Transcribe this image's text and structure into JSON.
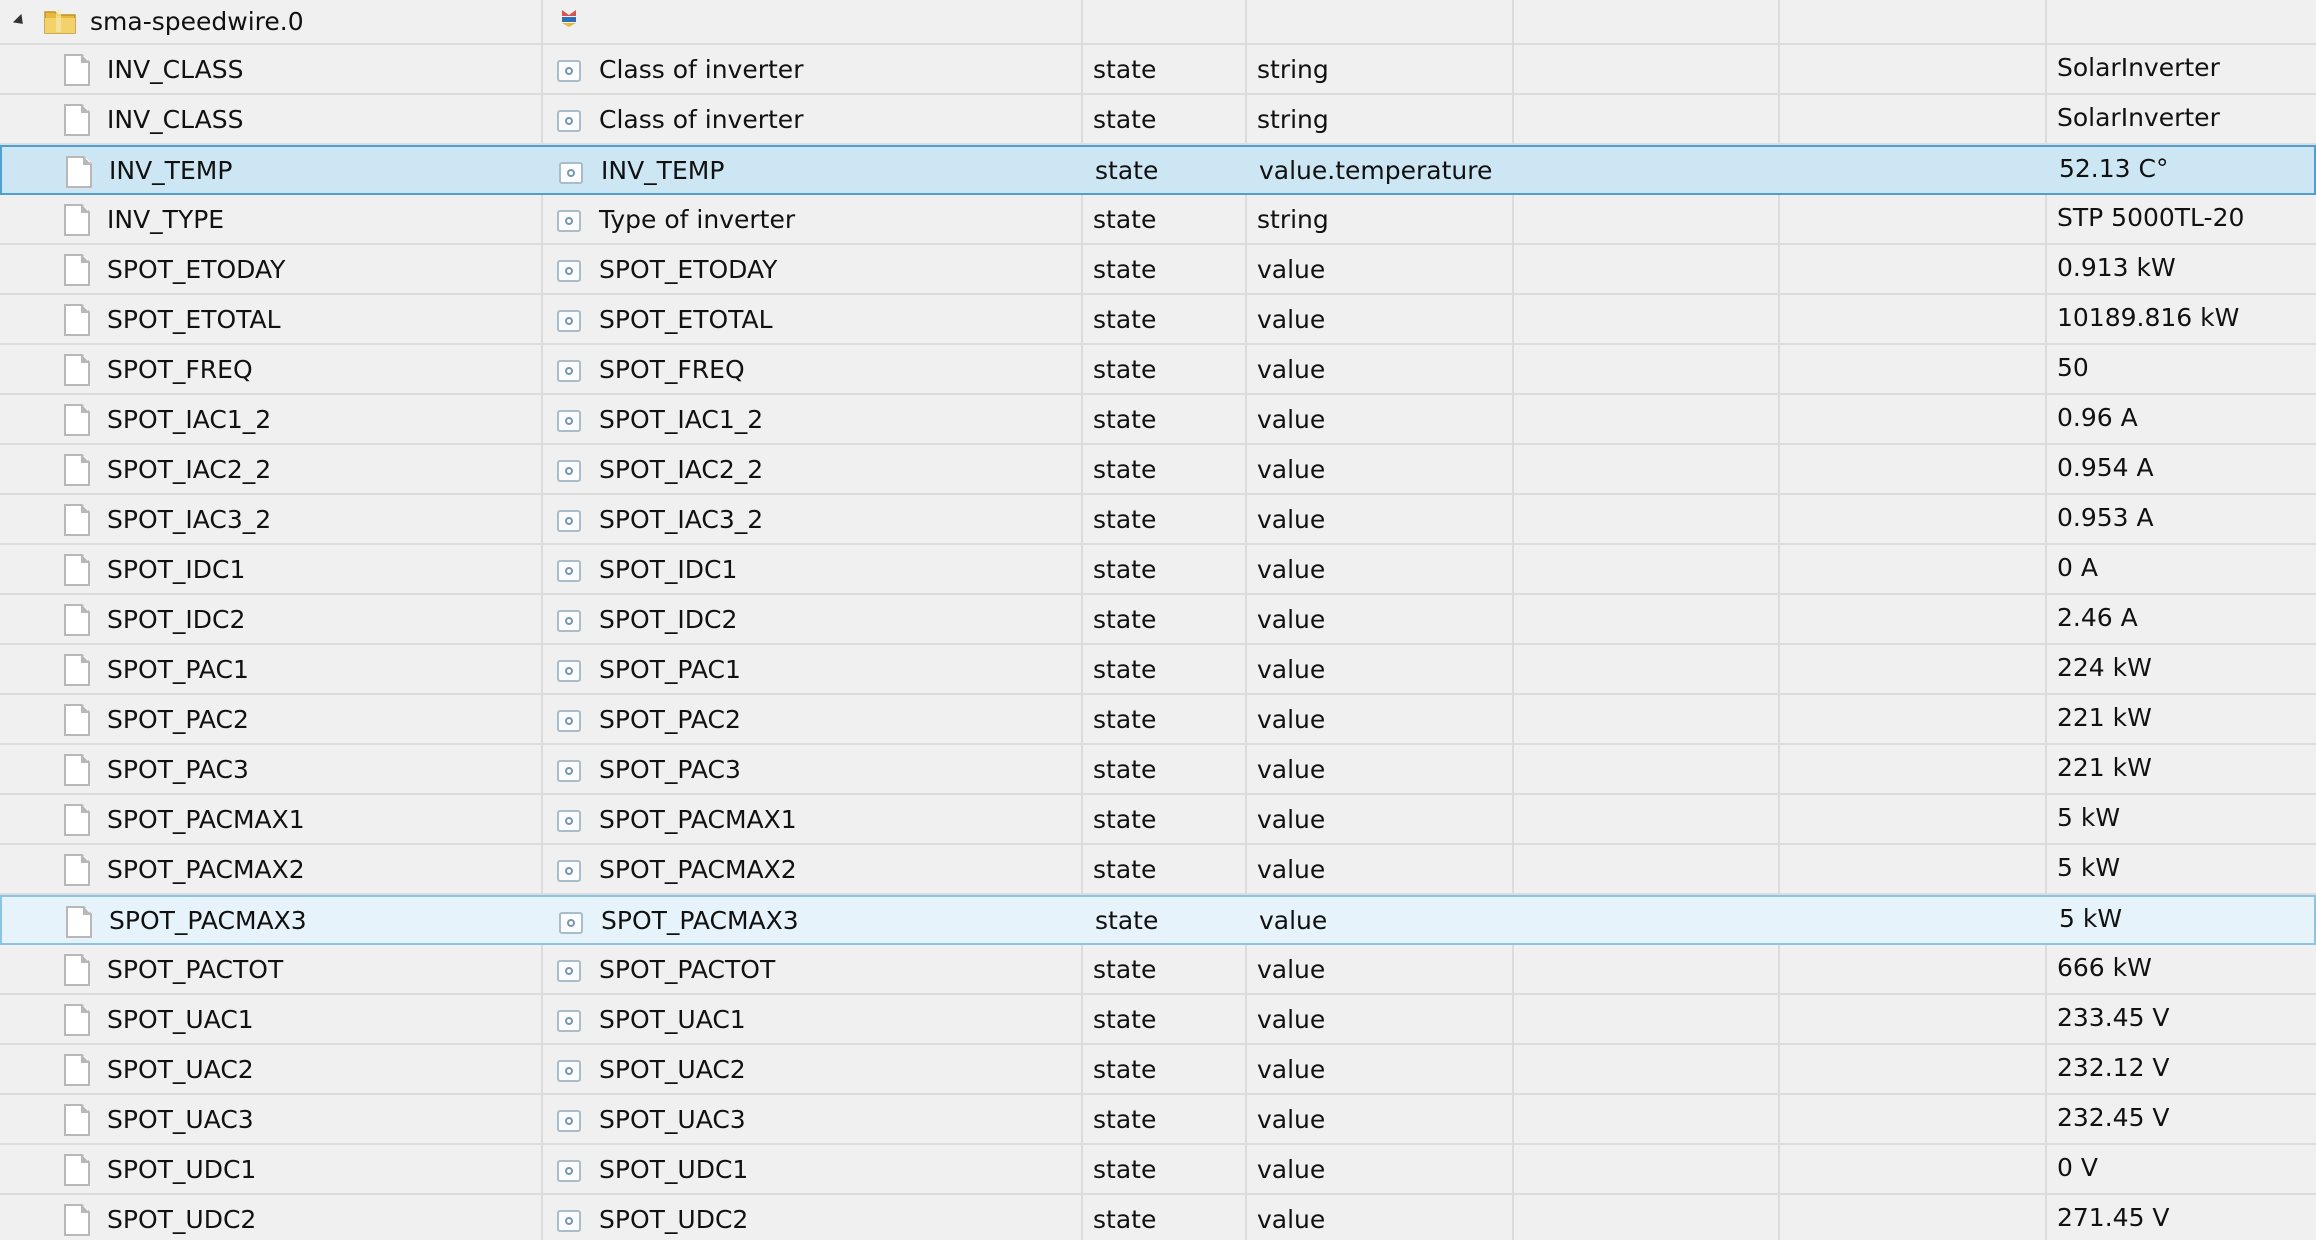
{
  "root": {
    "name": "sma-speedwire.0",
    "icons": {
      "toggle": "collapse-caret-icon",
      "folder": "folder-icon",
      "adapter": "adapter-logo-icon"
    }
  },
  "row_icons": {
    "object": "file-icon",
    "role": "state-icon"
  },
  "colors": {
    "background": "#f0f0f0",
    "row_border": "#dcdcdc",
    "selected_bg": "#cde6f3",
    "selected_border": "#4fa0d0",
    "hover_bg": "#e6f3fa",
    "hover_border": "#8cc4e3",
    "folder_yellow": "#e8b93a"
  },
  "rows": [
    {
      "name": "INV_CLASS",
      "description": "Class of inverter",
      "kind": "state",
      "role": "string",
      "value": "SolarInverter",
      "status": ""
    },
    {
      "name": "INV_CLASS",
      "description": "Class of inverter",
      "kind": "state",
      "role": "string",
      "value": "SolarInverter",
      "status": ""
    },
    {
      "name": "INV_TEMP",
      "description": "INV_TEMP",
      "kind": "state",
      "role": "value.temperature",
      "value": "52.13 C°",
      "status": "selected"
    },
    {
      "name": "INV_TYPE",
      "description": "Type of inverter",
      "kind": "state",
      "role": "string",
      "value": "STP 5000TL-20",
      "status": ""
    },
    {
      "name": "SPOT_ETODAY",
      "description": "SPOT_ETODAY",
      "kind": "state",
      "role": "value",
      "value": "0.913 kW",
      "status": ""
    },
    {
      "name": "SPOT_ETOTAL",
      "description": "SPOT_ETOTAL",
      "kind": "state",
      "role": "value",
      "value": "10189.816 kW",
      "status": ""
    },
    {
      "name": "SPOT_FREQ",
      "description": "SPOT_FREQ",
      "kind": "state",
      "role": "value",
      "value": "50",
      "status": ""
    },
    {
      "name": "SPOT_IAC1_2",
      "description": "SPOT_IAC1_2",
      "kind": "state",
      "role": "value",
      "value": "0.96 A",
      "status": ""
    },
    {
      "name": "SPOT_IAC2_2",
      "description": "SPOT_IAC2_2",
      "kind": "state",
      "role": "value",
      "value": "0.954 A",
      "status": ""
    },
    {
      "name": "SPOT_IAC3_2",
      "description": "SPOT_IAC3_2",
      "kind": "state",
      "role": "value",
      "value": "0.953 A",
      "status": ""
    },
    {
      "name": "SPOT_IDC1",
      "description": "SPOT_IDC1",
      "kind": "state",
      "role": "value",
      "value": "0 A",
      "status": ""
    },
    {
      "name": "SPOT_IDC2",
      "description": "SPOT_IDC2",
      "kind": "state",
      "role": "value",
      "value": "2.46 A",
      "status": ""
    },
    {
      "name": "SPOT_PAC1",
      "description": "SPOT_PAC1",
      "kind": "state",
      "role": "value",
      "value": "224 kW",
      "status": ""
    },
    {
      "name": "SPOT_PAC2",
      "description": "SPOT_PAC2",
      "kind": "state",
      "role": "value",
      "value": "221 kW",
      "status": ""
    },
    {
      "name": "SPOT_PAC3",
      "description": "SPOT_PAC3",
      "kind": "state",
      "role": "value",
      "value": "221 kW",
      "status": ""
    },
    {
      "name": "SPOT_PACMAX1",
      "description": "SPOT_PACMAX1",
      "kind": "state",
      "role": "value",
      "value": "5 kW",
      "status": ""
    },
    {
      "name": "SPOT_PACMAX2",
      "description": "SPOT_PACMAX2",
      "kind": "state",
      "role": "value",
      "value": "5 kW",
      "status": ""
    },
    {
      "name": "SPOT_PACMAX3",
      "description": "SPOT_PACMAX3",
      "kind": "state",
      "role": "value",
      "value": "5 kW",
      "status": "hovered"
    },
    {
      "name": "SPOT_PACTOT",
      "description": "SPOT_PACTOT",
      "kind": "state",
      "role": "value",
      "value": "666 kW",
      "status": ""
    },
    {
      "name": "SPOT_UAC1",
      "description": "SPOT_UAC1",
      "kind": "state",
      "role": "value",
      "value": "233.45 V",
      "status": ""
    },
    {
      "name": "SPOT_UAC2",
      "description": "SPOT_UAC2",
      "kind": "state",
      "role": "value",
      "value": "232.12 V",
      "status": ""
    },
    {
      "name": "SPOT_UAC3",
      "description": "SPOT_UAC3",
      "kind": "state",
      "role": "value",
      "value": "232.45 V",
      "status": ""
    },
    {
      "name": "SPOT_UDC1",
      "description": "SPOT_UDC1",
      "kind": "state",
      "role": "value",
      "value": "0 V",
      "status": ""
    },
    {
      "name": "SPOT_UDC2",
      "description": "SPOT_UDC2",
      "kind": "state",
      "role": "value",
      "value": "271.45 V",
      "status": ""
    }
  ]
}
